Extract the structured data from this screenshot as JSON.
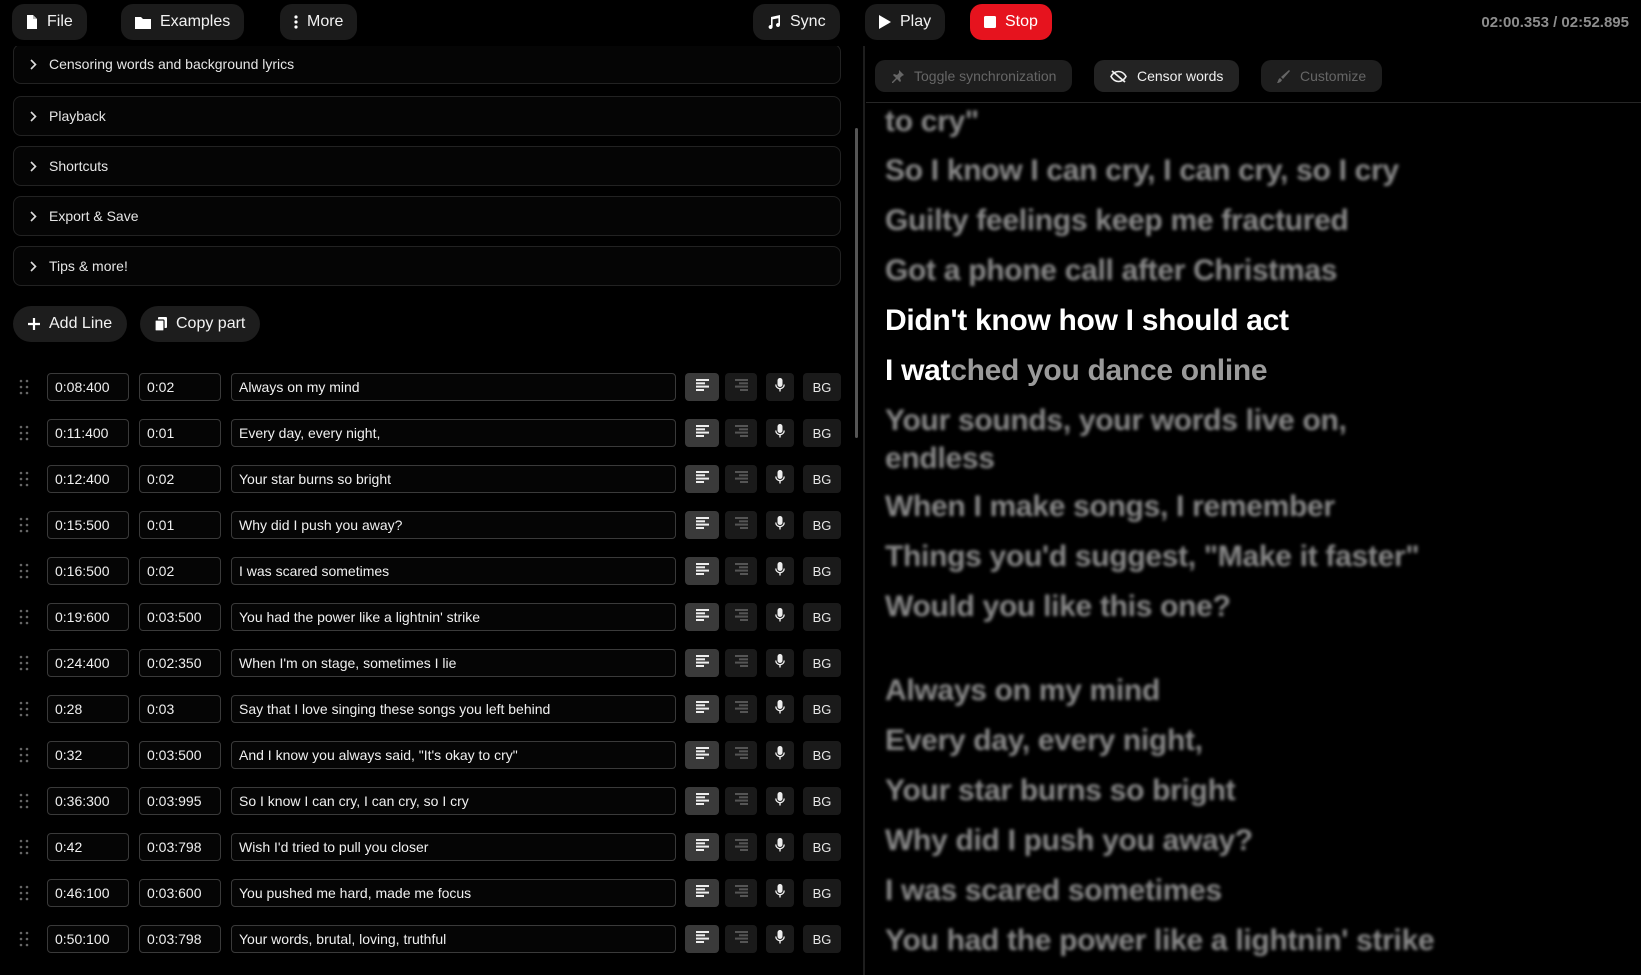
{
  "toolbar": {
    "file_label": "File",
    "examples_label": "Examples",
    "more_label": "More",
    "sync_label": "Sync",
    "play_label": "Play",
    "stop_label": "Stop",
    "time_display": "02:00.353 / 02:52.895"
  },
  "accordions": [
    "Censoring words and background lyrics",
    "Playback",
    "Shortcuts",
    "Export & Save",
    "Tips & more!"
  ],
  "actions": {
    "add_line": "Add Line",
    "copy_part": "Copy part"
  },
  "rows": [
    {
      "start": "0:08:400",
      "dur": "0:02",
      "text": "Always on my mind",
      "bg": "BG"
    },
    {
      "start": "0:11:400",
      "dur": "0:01",
      "text": "Every day, every night,",
      "bg": "BG"
    },
    {
      "start": "0:12:400",
      "dur": "0:02",
      "text": "Your star burns so bright",
      "bg": "BG"
    },
    {
      "start": "0:15:500",
      "dur": "0:01",
      "text": "Why did I push you away?",
      "bg": "BG"
    },
    {
      "start": "0:16:500",
      "dur": "0:02",
      "text": "I was scared sometimes",
      "bg": "BG"
    },
    {
      "start": "0:19:600",
      "dur": "0:03:500",
      "text": "You had the power like a lightnin' strike",
      "bg": "BG"
    },
    {
      "start": "0:24:400",
      "dur": "0:02:350",
      "text": "When I'm on stage, sometimes I lie",
      "bg": "BG"
    },
    {
      "start": "0:28",
      "dur": "0:03",
      "text": "Say that I love singing these songs you left behind",
      "bg": "BG"
    },
    {
      "start": "0:32",
      "dur": "0:03:500",
      "text": "And I know you always said, \"It's okay to cry\"",
      "bg": "BG"
    },
    {
      "start": "0:36:300",
      "dur": "0:03:995",
      "text": "So I know I can cry, I can cry, so I cry",
      "bg": "BG"
    },
    {
      "start": "0:42",
      "dur": "0:03:798",
      "text": "Wish I'd tried to pull you closer",
      "bg": "BG"
    },
    {
      "start": "0:46:100",
      "dur": "0:03:600",
      "text": "You pushed me hard, made me focus",
      "bg": "BG"
    },
    {
      "start": "0:50:100",
      "dur": "0:03:798",
      "text": "Your words, brutal, loving, truthful",
      "bg": "BG"
    }
  ],
  "preview": {
    "toggle_sync_label": "Toggle synchronization",
    "censor_label": "Censor words",
    "customize_label": "Customize",
    "lines": {
      "l0": "to cry\"",
      "l1": "So I know I can cry, I can cry, so I cry",
      "l2": "Guilty feelings keep me fractured",
      "l3": "Got a phone call after Christmas",
      "l4": "Didn't know how I should act",
      "l5_done": "I wat",
      "l5_rest": "ched you dance online",
      "l6a": "Your sounds, your words live on,",
      "l6b": "endless",
      "l7": "When I make songs, I remember",
      "l8": "Things you'd suggest, \"Make it faster\"",
      "l9": "Would you like this one?",
      "l10": "Always on my mind",
      "l11": "Every day, every night,",
      "l12": "Your star burns so bright",
      "l13": "Why did I push you away?",
      "l14": "I was scared sometimes",
      "l15": "You had the power like a lightnin' strike"
    }
  },
  "colors": {
    "stop": "#e6131e",
    "background": "#000000",
    "current_line": "#ffffff",
    "dim_line": "#8a8a8a"
  }
}
